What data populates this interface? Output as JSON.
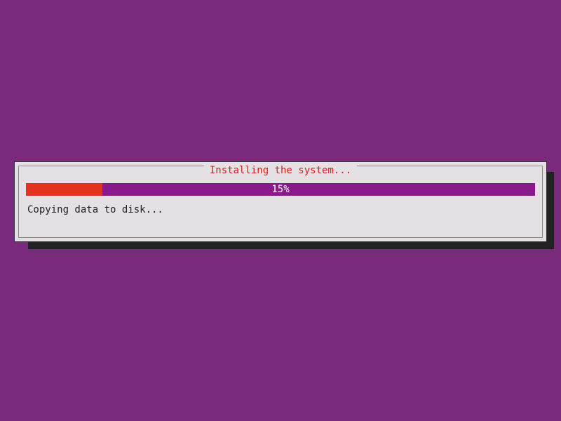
{
  "dialog": {
    "title": "Installing the system...",
    "progress_percent": 15,
    "progress_label": "15%",
    "status": "Copying data to disk..."
  }
}
